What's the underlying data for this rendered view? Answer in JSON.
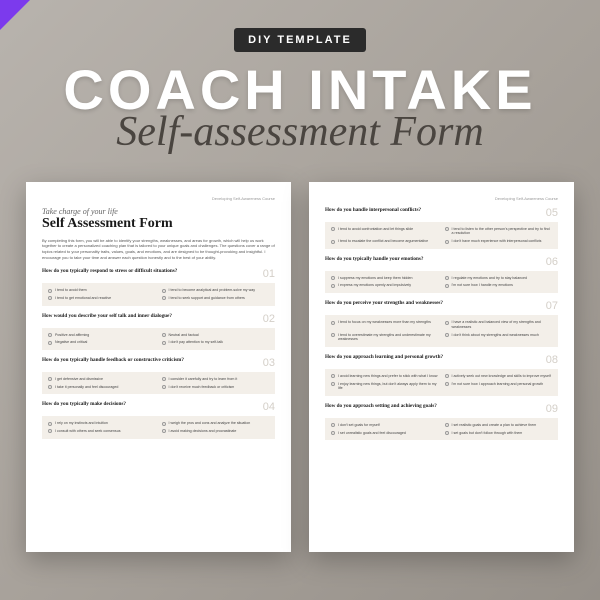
{
  "header": {
    "tag": "DIY TEMPLATE",
    "title": "COACH INTAKE",
    "subtitle": "Self-assessment Form"
  },
  "page_header_right": "Developing Self-Awareness Course",
  "page1": {
    "eyebrow": "Take charge of your life",
    "title": "Self Assessment Form",
    "intro": "By completing this form, you will be able to identify your strengths, weaknesses, and areas for growth, which will help us work together to create a personalized coaching plan that is tailored to your unique goals and challenges. The questions cover a range of topics related to your personality traits, values, goals, and emotions, and are designed to be thought-provoking and insightful. I encourage you to take your time and answer each question honestly and to the best of your ability.",
    "questions": [
      {
        "num": "01",
        "text": "How do you typically respond to stress or difficult situations?",
        "opts": [
          "I tend to avoid them",
          "I tend to become analytical and problem-solve my way",
          "I tend to get emotional and reactive",
          "I tend to seek support and guidance from others"
        ]
      },
      {
        "num": "02",
        "text": "How would you describe your self talk and inner dialogue?",
        "opts": [
          "Positive and affirming",
          "Neutral and factual",
          "Negative and critical",
          "I don't pay attention to my self-talk"
        ]
      },
      {
        "num": "03",
        "text": "How do you typically handle feedback or constructive criticism?",
        "opts": [
          "I get defensive and dismissive",
          "I consider it carefully and try to learn from it",
          "I take it personally and feel discouraged",
          "I don't receive much feedback or criticism"
        ]
      },
      {
        "num": "04",
        "text": "How do you typically make decisions?",
        "opts": [
          "I rely on my instincts and intuition",
          "I weigh the pros and cons and analyze the situation",
          "I consult with others and seek consensus",
          "I avoid making decisions and procrastinate"
        ]
      }
    ]
  },
  "page2": {
    "questions": [
      {
        "num": "05",
        "text": "How do you handle interpersonal conflicts?",
        "opts": [
          "I tend to avoid confrontation and let things slide",
          "I tend to listen to the other person's perspective and try to find a resolution",
          "I tend to escalate the conflict and become argumentative",
          "I don't have much experience with interpersonal conflicts"
        ]
      },
      {
        "num": "06",
        "text": "How do you typically handle your emotions?",
        "opts": [
          "I suppress my emotions and keep them hidden",
          "I regulate my emotions and try to stay balanced",
          "I express my emotions openly and impulsively",
          "I'm not sure how I handle my emotions"
        ]
      },
      {
        "num": "07",
        "text": "How do you perceive your strengths and weaknesses?",
        "opts": [
          "I tend to focus on my weaknesses more than my strengths",
          "I have a realistic and balanced view of my strengths and weaknesses",
          "I tend to overestimate my strengths and underestimate my weaknesses",
          "I don't think about my strengths and weaknesses much"
        ]
      },
      {
        "num": "08",
        "text": "How do you approach learning and personal growth?",
        "opts": [
          "I avoid learning new things and prefer to stick with what I know",
          "I actively seek out new knowledge and skills to improve myself",
          "I enjoy learning new things, but don't always apply them to my life",
          "I'm not sure how I approach learning and personal growth"
        ]
      },
      {
        "num": "09",
        "text": "How do you approach setting and achieving goals?",
        "opts": [
          "I don't set goals for myself",
          "I set realistic goals and create a plan to achieve them",
          "I set unrealistic goals and feel discouraged",
          "I set goals but don't follow through with them"
        ]
      }
    ]
  }
}
